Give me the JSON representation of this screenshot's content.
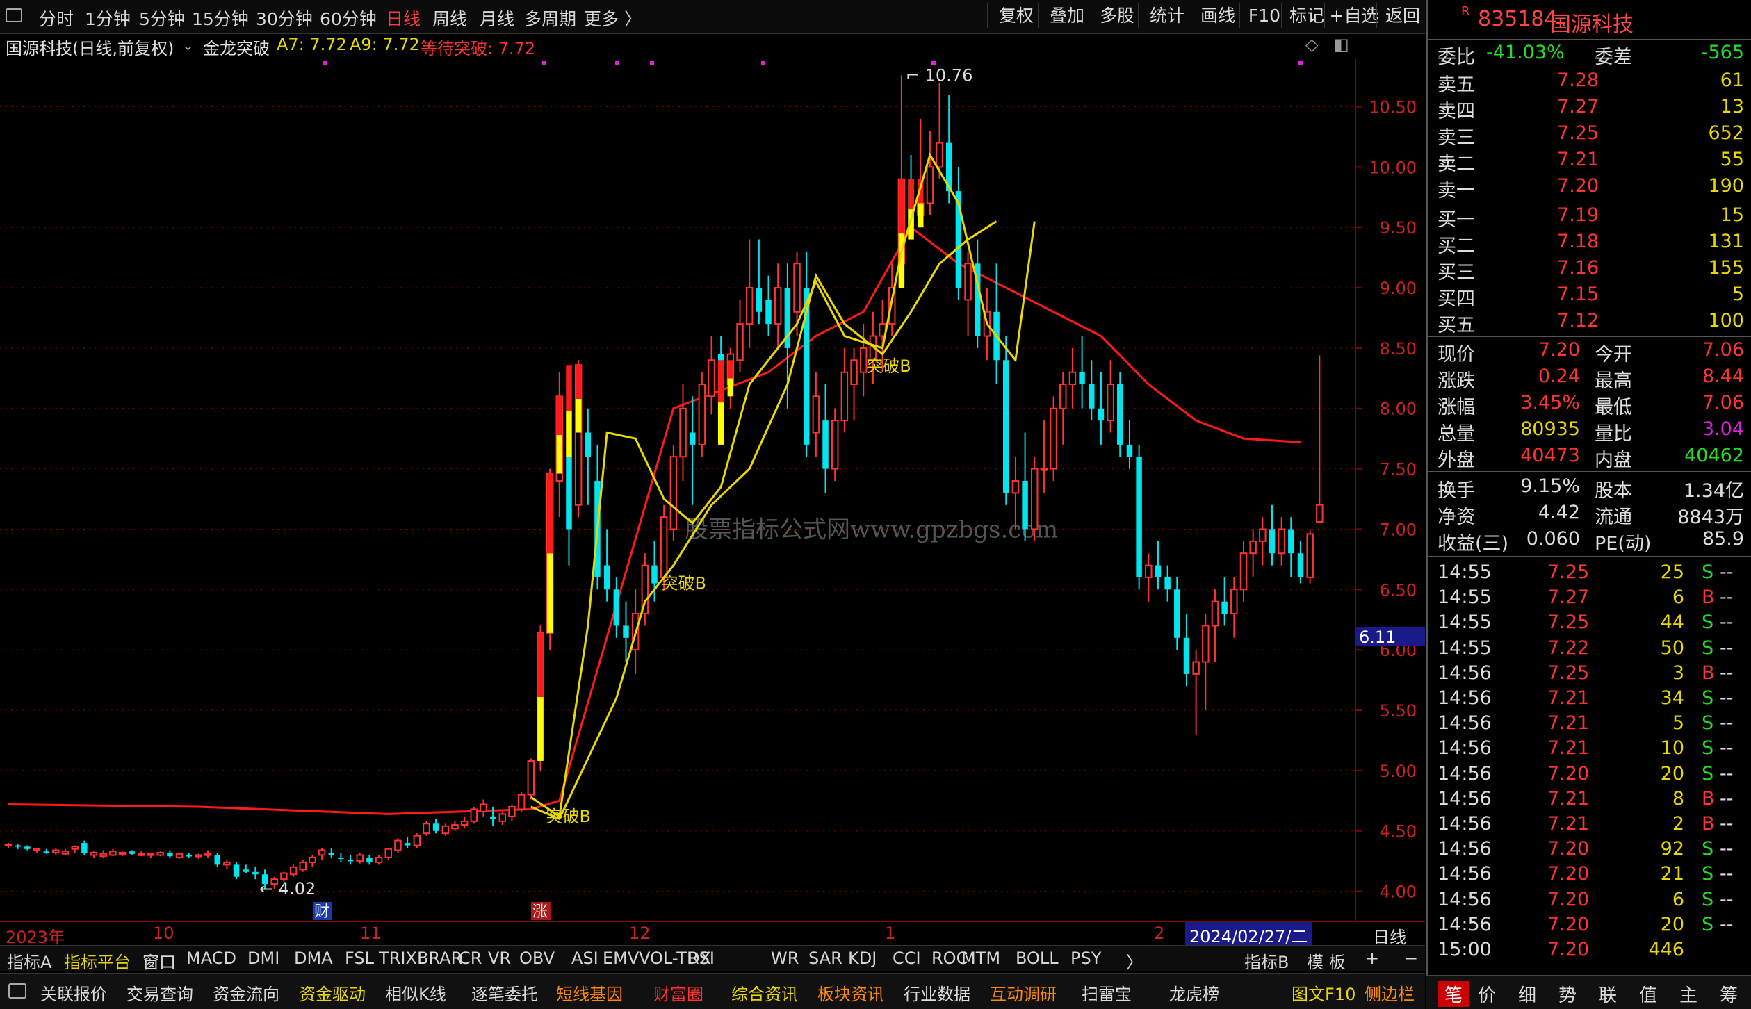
{
  "topbar": {
    "periods": [
      "分时",
      "1分钟",
      "5分钟",
      "15分钟",
      "30分钟",
      "60分钟",
      "日线",
      "周线",
      "月线",
      "多周期",
      "更多 〉"
    ],
    "active_period": "日线",
    "right_buttons": [
      "复权",
      "叠加",
      "多股",
      "统计",
      "画线",
      "F10",
      "标记",
      "+自选",
      "返回"
    ]
  },
  "chart_header": {
    "title": "国源科技(日线,前复权)",
    "indicator": "金龙突破",
    "a7": "A7: 7.72",
    "a9": "A9: 7.72",
    "status": "等待突破: 7.72"
  },
  "chart_labels": {
    "watermark": "股票指标公式网www.gpzbgs.com",
    "high_marker": "10.76",
    "low_marker": "4.02",
    "breakout_labels": [
      "突破B",
      "突破B",
      "突破B"
    ],
    "cai_marker": "财",
    "zhang_marker": "涨",
    "cursor_price": "6.11"
  },
  "colors": {
    "up": "#ff3333",
    "down": "#00e5ee",
    "ma": "#ff1a1a",
    "band": "#e8d800",
    "yellow_fill": "#ffff00",
    "grid": "#8b0000"
  },
  "xaxis": {
    "labels": [
      "2023年",
      "10",
      "11",
      "12",
      "1",
      "2"
    ],
    "cursor_date": "2024/02/27/二",
    "period_tag": "日线"
  },
  "indicator_tabs": [
    "指标A",
    "指标平台",
    "窗口",
    "MACD",
    "DMI",
    "DMA",
    "FSL",
    "TRIX",
    "BRAR",
    "CR",
    "VR",
    "OBV",
    "ASI",
    "EMV",
    "VOL-TDX",
    "RSI",
    "WR",
    "SAR",
    "KDJ",
    "CCI",
    "ROC",
    "MTM",
    "BOLL",
    "PSY",
    "〉"
  ],
  "indicator_right": [
    "指标B",
    "模 板",
    "+",
    "−"
  ],
  "bottombar": [
    "关联报价",
    "交易查询",
    "资金流向",
    "资金驱动",
    "相似K线",
    "逐笔委托",
    "短线基因",
    "财富圈",
    "综合资讯",
    "板块资讯",
    "行业数据",
    "互动调研",
    "扫雷宝",
    "龙虎榜",
    "图文F10",
    "侧边栏"
  ],
  "stock": {
    "code": "835184",
    "name": "国源科技",
    "badge": "R"
  },
  "order": {
    "wb_label": "委比",
    "wb": "-41.03%",
    "wc_label": "委差",
    "wc": "-565"
  },
  "asks": [
    {
      "label": "卖五",
      "price": "7.28",
      "vol": "61"
    },
    {
      "label": "卖四",
      "price": "7.27",
      "vol": "13"
    },
    {
      "label": "卖三",
      "price": "7.25",
      "vol": "652"
    },
    {
      "label": "卖二",
      "price": "7.21",
      "vol": "55"
    },
    {
      "label": "卖一",
      "price": "7.20",
      "vol": "190"
    }
  ],
  "bids": [
    {
      "label": "买一",
      "price": "7.19",
      "vol": "15"
    },
    {
      "label": "买二",
      "price": "7.18",
      "vol": "131"
    },
    {
      "label": "买三",
      "price": "7.16",
      "vol": "155"
    },
    {
      "label": "买四",
      "price": "7.15",
      "vol": "5"
    },
    {
      "label": "买五",
      "price": "7.12",
      "vol": "100"
    }
  ],
  "quote": [
    {
      "l1": "现价",
      "v1": "7.20",
      "l2": "今开",
      "v2": "7.06"
    },
    {
      "l1": "涨跌",
      "v1": "0.24",
      "l2": "最高",
      "v2": "8.44"
    },
    {
      "l1": "涨幅",
      "v1": "3.45%",
      "l2": "最低",
      "v2": "7.06"
    },
    {
      "l1": "总量",
      "v1": "80935",
      "l2": "量比",
      "v2": "3.04"
    },
    {
      "l1": "外盘",
      "v1": "40473",
      "l2": "内盘",
      "v2": "40462"
    }
  ],
  "quote2": [
    {
      "l1": "换手",
      "v1": "9.15%",
      "l2": "股本",
      "v2": "1.34亿"
    },
    {
      "l1": "净资",
      "v1": "4.42",
      "l2": "流通",
      "v2": "8843万"
    },
    {
      "l1": "收益(三)",
      "v1": "0.060",
      "l2": "PE(动)",
      "v2": "85.9"
    }
  ],
  "ticks": [
    {
      "t": "14:55",
      "p": "7.25",
      "v": "25",
      "s": "S"
    },
    {
      "t": "14:55",
      "p": "7.27",
      "v": "6",
      "s": "B"
    },
    {
      "t": "14:55",
      "p": "7.25",
      "v": "44",
      "s": "S"
    },
    {
      "t": "14:55",
      "p": "7.22",
      "v": "50",
      "s": "S"
    },
    {
      "t": "14:56",
      "p": "7.25",
      "v": "3",
      "s": "B"
    },
    {
      "t": "14:56",
      "p": "7.21",
      "v": "34",
      "s": "S"
    },
    {
      "t": "14:56",
      "p": "7.21",
      "v": "5",
      "s": "S"
    },
    {
      "t": "14:56",
      "p": "7.21",
      "v": "10",
      "s": "S"
    },
    {
      "t": "14:56",
      "p": "7.20",
      "v": "20",
      "s": "S"
    },
    {
      "t": "14:56",
      "p": "7.21",
      "v": "8",
      "s": "B"
    },
    {
      "t": "14:56",
      "p": "7.21",
      "v": "2",
      "s": "B"
    },
    {
      "t": "14:56",
      "p": "7.20",
      "v": "92",
      "s": "S"
    },
    {
      "t": "14:56",
      "p": "7.20",
      "v": "21",
      "s": "S"
    },
    {
      "t": "14:56",
      "p": "7.20",
      "v": "6",
      "s": "S"
    },
    {
      "t": "14:56",
      "p": "7.20",
      "v": "20",
      "s": "S"
    },
    {
      "t": "15:00",
      "p": "7.20",
      "v": "446",
      "s": ""
    }
  ],
  "tick_dash": "--",
  "right_tabs": [
    "笔",
    "价",
    "细",
    "势",
    "联",
    "值",
    "主",
    "筹"
  ],
  "chart_data": {
    "type": "candlestick",
    "title": "国源科技(日线,前复权)",
    "y_ticks": [
      4.0,
      4.5,
      5.0,
      5.5,
      6.0,
      6.5,
      7.0,
      7.5,
      8.0,
      8.5,
      9.0,
      9.5,
      10.0,
      10.5
    ],
    "ylim": [
      3.75,
      10.9
    ],
    "x_labels": [
      "2023年",
      "10",
      "11",
      "12",
      "1",
      "2"
    ],
    "candles": [
      [
        4.38,
        4.4,
        4.36,
        4.39
      ],
      [
        4.38,
        4.39,
        4.35,
        4.37
      ],
      [
        4.37,
        4.38,
        4.34,
        4.35
      ],
      [
        4.34,
        4.36,
        4.32,
        4.35
      ],
      [
        4.33,
        4.35,
        4.31,
        4.32
      ],
      [
        4.32,
        4.36,
        4.3,
        4.34
      ],
      [
        4.31,
        4.35,
        4.3,
        4.33
      ],
      [
        4.35,
        4.38,
        4.32,
        4.37
      ],
      [
        4.4,
        4.42,
        4.3,
        4.32
      ],
      [
        4.3,
        4.33,
        4.28,
        4.32
      ],
      [
        4.29,
        4.34,
        4.28,
        4.31
      ],
      [
        4.3,
        4.35,
        4.29,
        4.33
      ],
      [
        4.31,
        4.33,
        4.29,
        4.32
      ],
      [
        4.33,
        4.34,
        4.3,
        4.31
      ],
      [
        4.3,
        4.33,
        4.29,
        4.31
      ],
      [
        4.3,
        4.32,
        4.28,
        4.31
      ],
      [
        4.3,
        4.33,
        4.29,
        4.32
      ],
      [
        4.32,
        4.34,
        4.28,
        4.29
      ],
      [
        4.28,
        4.32,
        4.27,
        4.31
      ],
      [
        4.3,
        4.32,
        4.28,
        4.29
      ],
      [
        4.29,
        4.31,
        4.27,
        4.3
      ],
      [
        4.3,
        4.34,
        4.28,
        4.31
      ],
      [
        4.3,
        4.32,
        4.2,
        4.22
      ],
      [
        4.22,
        4.26,
        4.18,
        4.24
      ],
      [
        4.22,
        4.24,
        4.1,
        4.12
      ],
      [
        4.18,
        4.22,
        4.15,
        4.16
      ],
      [
        4.16,
        4.2,
        4.1,
        4.14
      ],
      [
        4.14,
        4.18,
        4.02,
        4.06
      ],
      [
        4.06,
        4.12,
        4.02,
        4.1
      ],
      [
        4.1,
        4.16,
        4.08,
        4.15
      ],
      [
        4.14,
        4.22,
        4.12,
        4.2
      ],
      [
        4.18,
        4.26,
        4.16,
        4.24
      ],
      [
        4.24,
        4.3,
        4.2,
        4.28
      ],
      [
        4.3,
        4.36,
        4.26,
        4.34
      ],
      [
        4.32,
        4.36,
        4.28,
        4.3
      ],
      [
        4.28,
        4.32,
        4.24,
        4.27
      ],
      [
        4.26,
        4.3,
        4.22,
        4.25
      ],
      [
        4.25,
        4.32,
        4.23,
        4.3
      ],
      [
        4.28,
        4.3,
        4.22,
        4.24
      ],
      [
        4.24,
        4.3,
        4.22,
        4.28
      ],
      [
        4.28,
        4.36,
        4.26,
        4.35
      ],
      [
        4.34,
        4.44,
        4.32,
        4.42
      ],
      [
        4.4,
        4.45,
        4.36,
        4.38
      ],
      [
        4.38,
        4.48,
        4.36,
        4.46
      ],
      [
        4.48,
        4.58,
        4.46,
        4.56
      ],
      [
        4.56,
        4.6,
        4.48,
        4.5
      ],
      [
        4.48,
        4.56,
        4.46,
        4.54
      ],
      [
        4.52,
        4.58,
        4.5,
        4.55
      ],
      [
        4.55,
        4.62,
        4.52,
        4.58
      ],
      [
        4.58,
        4.7,
        4.56,
        4.68
      ],
      [
        4.66,
        4.76,
        4.62,
        4.72
      ],
      [
        4.62,
        4.7,
        4.54,
        4.6
      ],
      [
        4.58,
        4.66,
        4.55,
        4.64
      ],
      [
        4.62,
        4.72,
        4.58,
        4.7
      ],
      [
        4.68,
        4.82,
        4.66,
        4.8
      ],
      [
        4.8,
        5.1,
        4.76,
        5.08
      ],
      [
        5.1,
        6.2,
        5.0,
        6.14
      ],
      [
        6.14,
        7.5,
        6.0,
        7.46
      ],
      [
        7.4,
        8.3,
        7.1,
        8.1
      ],
      [
        7.6,
        8.0,
        6.7,
        7.0
      ],
      [
        7.2,
        8.4,
        7.1,
        8.36
      ],
      [
        7.8,
        8.0,
        7.2,
        7.6
      ],
      [
        7.4,
        7.7,
        6.5,
        6.6
      ],
      [
        6.7,
        7.0,
        6.4,
        6.5
      ],
      [
        6.5,
        6.6,
        6.1,
        6.2
      ],
      [
        6.2,
        6.4,
        5.9,
        6.1
      ],
      [
        6.0,
        6.5,
        5.8,
        6.3
      ],
      [
        6.3,
        6.8,
        6.2,
        6.7
      ],
      [
        6.7,
        6.9,
        6.4,
        6.55
      ],
      [
        6.6,
        7.2,
        6.5,
        7.1
      ],
      [
        7.0,
        7.7,
        6.9,
        7.6
      ],
      [
        7.6,
        8.2,
        7.4,
        8.0
      ],
      [
        7.8,
        8.1,
        7.2,
        7.7
      ],
      [
        7.7,
        8.3,
        7.6,
        8.2
      ],
      [
        8.1,
        8.6,
        7.95,
        8.4
      ],
      [
        8.45,
        8.6,
        8.1,
        8.3
      ],
      [
        8.2,
        8.5,
        8.0,
        8.45
      ],
      [
        8.4,
        8.9,
        8.3,
        8.7
      ],
      [
        8.7,
        9.4,
        8.5,
        9.0
      ],
      [
        9.0,
        9.4,
        8.7,
        8.8
      ],
      [
        8.9,
        9.1,
        8.6,
        8.7
      ],
      [
        8.7,
        9.2,
        8.5,
        9.0
      ],
      [
        9.0,
        9.2,
        8.0,
        8.5
      ],
      [
        8.8,
        9.3,
        8.6,
        9.2
      ],
      [
        9.0,
        9.3,
        7.6,
        7.7
      ],
      [
        7.8,
        8.3,
        7.6,
        8.1
      ],
      [
        7.9,
        8.2,
        7.3,
        7.5
      ],
      [
        7.5,
        8.0,
        7.4,
        7.9
      ],
      [
        7.9,
        8.5,
        7.8,
        8.3
      ],
      [
        8.2,
        8.5,
        7.9,
        8.4
      ],
      [
        8.3,
        8.7,
        8.1,
        8.5
      ],
      [
        8.4,
        8.8,
        8.2,
        8.6
      ],
      [
        8.6,
        8.9,
        8.3,
        8.7
      ],
      [
        8.7,
        9.2,
        8.6,
        9.0
      ],
      [
        9.2,
        10.76,
        9.1,
        9.9
      ],
      [
        9.9,
        10.1,
        9.4,
        9.5
      ],
      [
        9.6,
        10.4,
        9.5,
        9.7
      ],
      [
        9.7,
        10.3,
        9.6,
        10.0
      ],
      [
        10.0,
        10.7,
        9.9,
        10.2
      ],
      [
        10.2,
        10.6,
        9.7,
        9.8
      ],
      [
        9.8,
        10.0,
        8.9,
        9.0
      ],
      [
        8.9,
        9.3,
        8.6,
        9.2
      ],
      [
        9.2,
        9.4,
        8.5,
        8.6
      ],
      [
        8.6,
        9.0,
        8.4,
        8.8
      ],
      [
        8.8,
        9.2,
        8.2,
        8.4
      ],
      [
        8.4,
        8.6,
        7.2,
        7.3
      ],
      [
        7.3,
        7.6,
        7.0,
        7.4
      ],
      [
        7.4,
        7.8,
        6.9,
        7.0
      ],
      [
        7.0,
        7.6,
        6.9,
        7.5
      ],
      [
        7.5,
        7.9,
        7.3,
        7.5
      ],
      [
        7.5,
        8.1,
        7.4,
        8.0
      ],
      [
        8.0,
        8.3,
        7.7,
        8.2
      ],
      [
        8.2,
        8.5,
        8.0,
        8.3
      ],
      [
        8.3,
        8.6,
        8.0,
        8.2
      ],
      [
        8.2,
        8.4,
        7.9,
        8.0
      ],
      [
        8.0,
        8.3,
        7.7,
        7.9
      ],
      [
        7.9,
        8.4,
        7.8,
        8.2
      ],
      [
        8.2,
        8.3,
        7.6,
        7.7
      ],
      [
        7.7,
        7.9,
        7.5,
        7.6
      ],
      [
        7.6,
        7.7,
        6.5,
        6.6
      ],
      [
        6.6,
        6.8,
        6.4,
        6.7
      ],
      [
        6.7,
        6.9,
        6.5,
        6.6
      ],
      [
        6.6,
        6.7,
        6.4,
        6.5
      ],
      [
        6.5,
        6.6,
        6.0,
        6.1
      ],
      [
        6.1,
        6.3,
        5.7,
        5.8
      ],
      [
        5.8,
        6.0,
        5.3,
        5.9
      ],
      [
        5.9,
        6.3,
        5.5,
        6.2
      ],
      [
        6.2,
        6.5,
        5.9,
        6.4
      ],
      [
        6.4,
        6.6,
        6.2,
        6.3
      ],
      [
        6.3,
        6.6,
        6.1,
        6.5
      ],
      [
        6.5,
        6.9,
        6.4,
        6.8
      ],
      [
        6.8,
        7.0,
        6.6,
        6.9
      ],
      [
        6.9,
        7.1,
        6.7,
        7.0
      ],
      [
        7.0,
        7.2,
        6.7,
        6.8
      ],
      [
        6.8,
        7.1,
        6.7,
        7.0
      ],
      [
        7.0,
        7.1,
        6.6,
        6.8
      ],
      [
        6.8,
        6.9,
        6.55,
        6.6
      ],
      [
        6.6,
        7.0,
        6.55,
        6.96
      ],
      [
        7.06,
        8.44,
        7.06,
        7.2
      ]
    ],
    "ma_line": [
      [
        0,
        4.72
      ],
      [
        20,
        4.7
      ],
      [
        40,
        4.64
      ],
      [
        55,
        4.68
      ],
      [
        58,
        4.75
      ],
      [
        70,
        8.0
      ],
      [
        80,
        8.3
      ],
      [
        85,
        8.6
      ],
      [
        90,
        8.8
      ],
      [
        95,
        9.5
      ],
      [
        100,
        9.2
      ],
      [
        105,
        9.0
      ],
      [
        110,
        8.8
      ],
      [
        115,
        8.6
      ],
      [
        120,
        8.2
      ],
      [
        125,
        7.9
      ],
      [
        130,
        7.75
      ],
      [
        136,
        7.72
      ]
    ],
    "band_line": [
      [
        55,
        4.78
      ],
      [
        58,
        4.62
      ],
      [
        61,
        6.2
      ],
      [
        63,
        7.8
      ],
      [
        66,
        7.75
      ],
      [
        69,
        7.25
      ],
      [
        72,
        7.05
      ],
      [
        75,
        7.35
      ],
      [
        78,
        8.2
      ],
      [
        83,
        8.7
      ],
      [
        85,
        9.05
      ],
      [
        88,
        8.6
      ],
      [
        92,
        8.5
      ],
      [
        94,
        9.3
      ],
      [
        97,
        10.1
      ],
      [
        100,
        9.7
      ],
      [
        103,
        8.7
      ],
      [
        106,
        8.4
      ],
      [
        108,
        9.55
      ]
    ],
    "band_line2": [
      [
        55,
        4.7
      ],
      [
        58,
        4.6
      ],
      [
        64,
        5.6
      ],
      [
        67,
        6.4
      ],
      [
        70,
        6.7
      ],
      [
        74,
        7.2
      ],
      [
        78,
        7.5
      ],
      [
        82,
        8.2
      ],
      [
        85,
        9.1
      ],
      [
        88,
        8.7
      ],
      [
        92,
        8.45
      ],
      [
        95,
        8.8
      ],
      [
        98,
        9.2
      ],
      [
        101,
        9.4
      ],
      [
        104,
        9.55
      ]
    ]
  }
}
